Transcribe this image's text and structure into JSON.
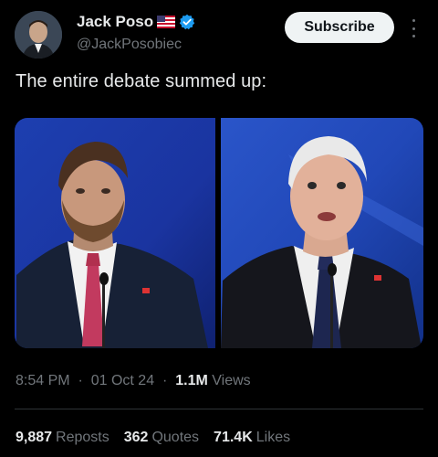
{
  "author": {
    "display_name": "Jack Poso",
    "handle": "@JackPosobiec"
  },
  "subscribe_label": "Subscribe",
  "tweet": {
    "text": "The entire debate summed up:"
  },
  "meta": {
    "time": "8:54 PM",
    "date": "01 Oct 24",
    "views_count": "1.1M",
    "views_label": "Views"
  },
  "stats": {
    "reposts_count": "9,887",
    "reposts_label": "Reposts",
    "quotes_count": "362",
    "quotes_label": "Quotes",
    "likes_count": "71.4K",
    "likes_label": "Likes"
  },
  "colors": {
    "background": "#000000",
    "text_primary": "#e7e9ea",
    "text_secondary": "#71767b",
    "verified_blue": "#1d9bf0",
    "subscribe_bg": "#eff3f4"
  }
}
